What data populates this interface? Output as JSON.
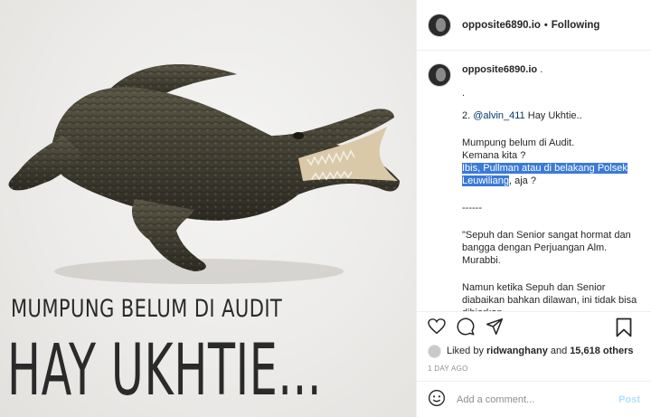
{
  "image": {
    "overlay_line1": "MUMPUNG BELUM DI AUDIT",
    "overlay_line2": "HAY UKHTIE..."
  },
  "header": {
    "username": "opposite6890.io",
    "separator": "•",
    "follow_state": "Following"
  },
  "caption": {
    "username": "opposite6890.io",
    "after_name": " .",
    "dot_line": ".",
    "mention_prefix": "2. ",
    "mention": "@alvin_411",
    "mention_suffix": " Hay Ukhtie..",
    "line_a": "Mumpung belum di Audit.",
    "line_b": "Kemana kita ?",
    "selected_text": "Ibis, Pullman atau di belakang Polsek Leuwiliang",
    "after_selected": ", aja ?",
    "divider": "------",
    "quote_1": "\"Sepuh dan Senior sangat hormat dan bangga dengan Perjuangan Alm. Murabbi.",
    "quote_2": "Namun ketika Sepuh dan Senior diabaikan bahkan dilawan, ini tidak bisa dibiarkan"
  },
  "likes": {
    "prefix": "Liked by ",
    "user": "ridwanghany",
    "middle": " and ",
    "count": "15,618 others"
  },
  "timestamp": "1 DAY AGO",
  "comment_box": {
    "placeholder": "Add a comment...",
    "post_label": "Post"
  },
  "colors": {
    "link": "#00376b",
    "selection": "#3b7ad8",
    "post_button": "#b2dffc",
    "muted": "#8e8e8e"
  }
}
